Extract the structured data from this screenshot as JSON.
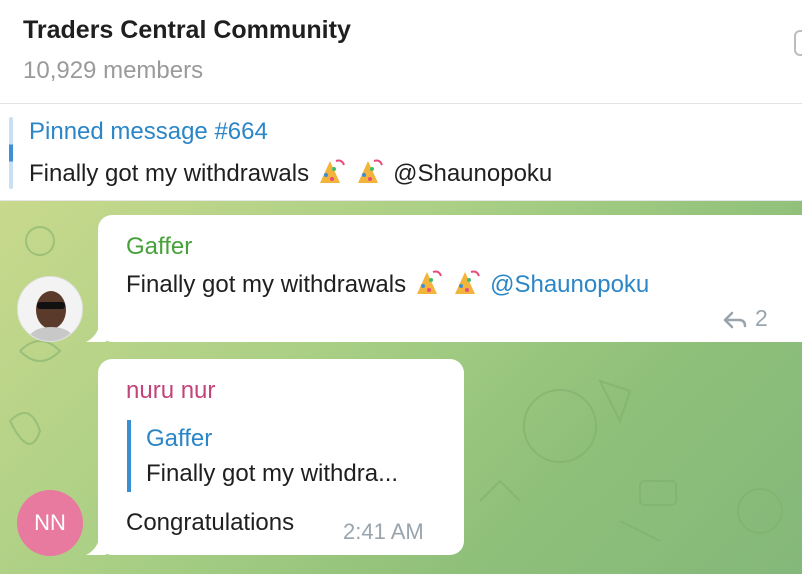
{
  "header": {
    "title": "Traders Central Community",
    "members": "10,929 members"
  },
  "pinned": {
    "title": "Pinned message #664",
    "text": "Finally got my withdrawals",
    "mention": "@Shaunopoku"
  },
  "messages": [
    {
      "sender": "Gaffer",
      "text": "Finally got my withdrawals",
      "mention": "@Shaunopoku",
      "reply_count": "2",
      "avatar": "photo-avatar"
    },
    {
      "sender": "nuru nur",
      "reply_to": {
        "name": "Gaffer",
        "text": "Finally got my withdra..."
      },
      "text": "Congratulations",
      "time": "2:41 AM",
      "avatar_initials": "NN"
    }
  ],
  "icons": {
    "emoji": "party-popper-icon",
    "reply": "reply-arrow-icon"
  },
  "colors": {
    "accent": "#2b86c7",
    "sender1": "#47a13a",
    "sender2": "#c2447a",
    "avatar2": "#e8799f"
  }
}
